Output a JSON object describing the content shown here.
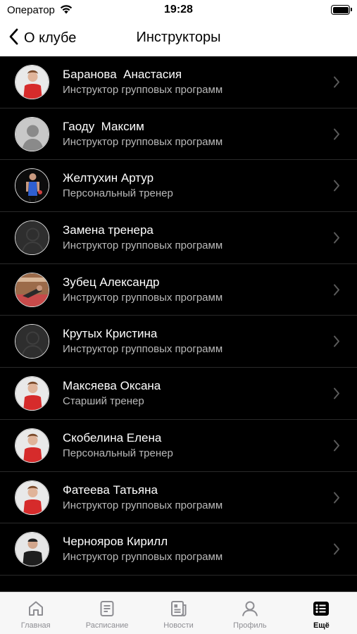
{
  "status_bar": {
    "carrier": "Оператор",
    "time": "19:28"
  },
  "nav": {
    "back_label": "О клубе",
    "title": "Инструкторы"
  },
  "instructors": [
    {
      "name": "Баранова  Анастасия",
      "role": "Инструктор групповых программ",
      "avatar": "photo-red-shirt"
    },
    {
      "name": "Гаоду  Максим",
      "role": "Инструктор групповых программ",
      "avatar": "placeholder-light"
    },
    {
      "name": "Желтухин Артур",
      "role": "Персональный тренер",
      "avatar": "photo-blue-tank"
    },
    {
      "name": "Замена тренера",
      "role": "Инструктор групповых программ",
      "avatar": "placeholder-dark"
    },
    {
      "name": "Зубец Александр",
      "role": "Инструктор групповых программ",
      "avatar": "photo-gym-floor"
    },
    {
      "name": "Крутых Кристина",
      "role": "Инструктор групповых программ",
      "avatar": "placeholder-dark"
    },
    {
      "name": "Максяева Оксана",
      "role": "Старший тренер",
      "avatar": "photo-red-shirt"
    },
    {
      "name": "Скобелина Елена",
      "role": "Персональный тренер",
      "avatar": "photo-red-shirt"
    },
    {
      "name": "Фатеева Татьяна",
      "role": "Инструктор групповых программ",
      "avatar": "photo-red-shirt"
    },
    {
      "name": "Чернояров Кирилл",
      "role": "Инструктор групповых программ",
      "avatar": "photo-dark-shirt"
    }
  ],
  "tabs": [
    {
      "label": "Главная",
      "icon": "home-icon",
      "active": false
    },
    {
      "label": "Расписание",
      "icon": "schedule-icon",
      "active": false
    },
    {
      "label": "Новости",
      "icon": "news-icon",
      "active": false
    },
    {
      "label": "Профиль",
      "icon": "profile-icon",
      "active": false
    },
    {
      "label": "Ещё",
      "icon": "more-icon",
      "active": true
    }
  ],
  "colors": {
    "list_bg": "#000000",
    "subtitle": "#b9b9b9",
    "tab_inactive": "#8e8e93",
    "tab_active": "#000000",
    "shirt_red": "#d62b2b"
  }
}
